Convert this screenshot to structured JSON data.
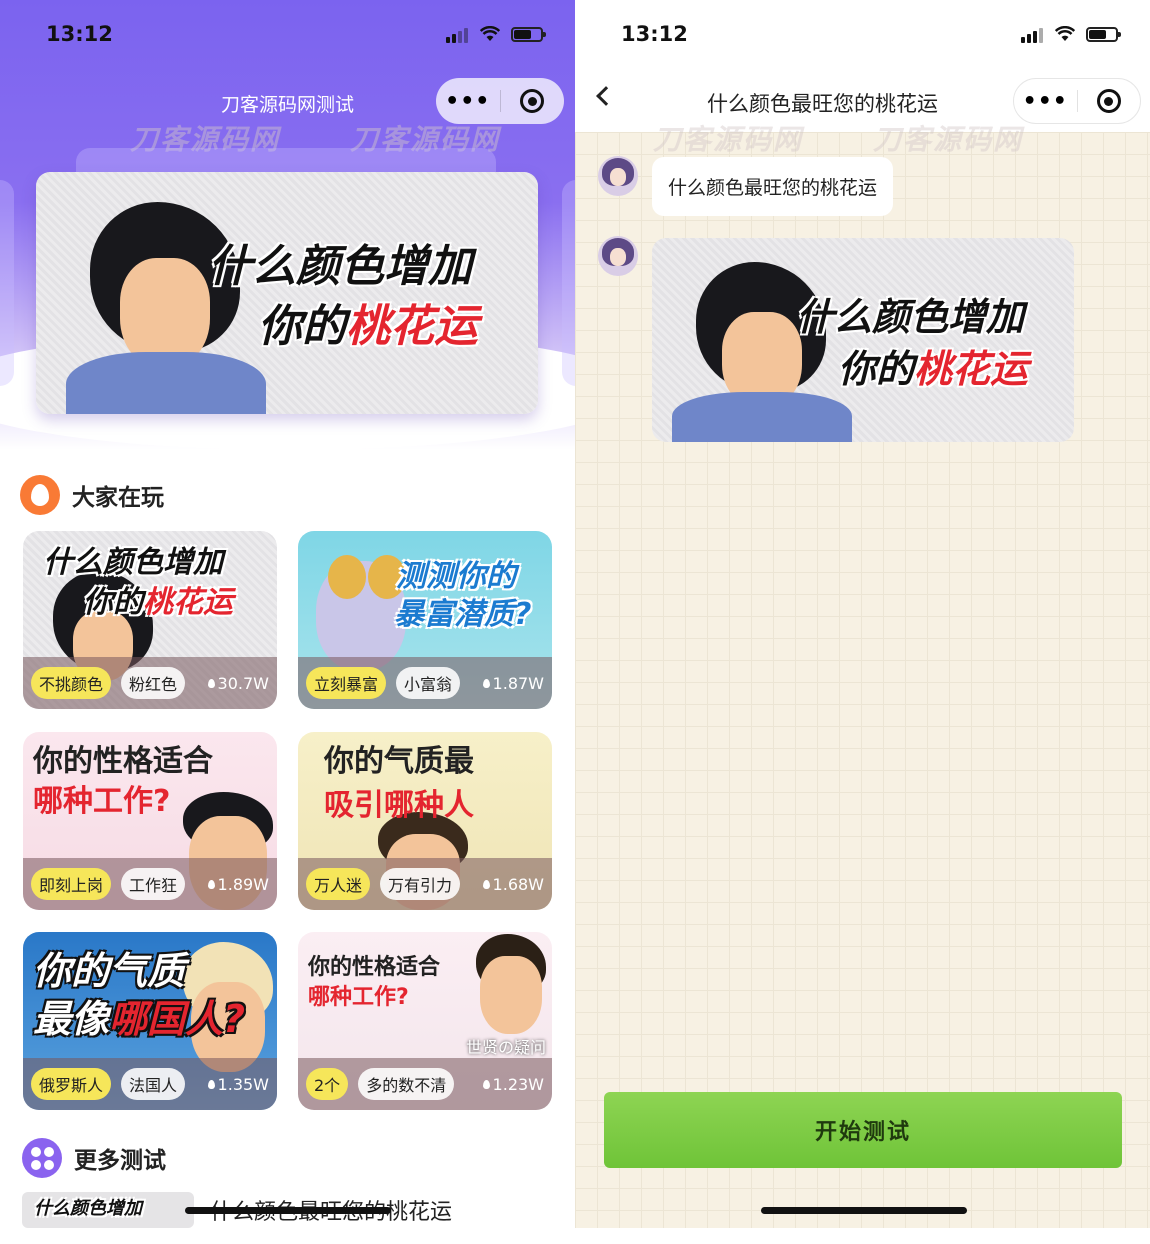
{
  "left": {
    "status": {
      "time": "13:12"
    },
    "nav_title": "刀客源码网测试",
    "watermark": "刀客源码网",
    "banner": {
      "line1": "什么颜色增加",
      "line2_prefix": "你的",
      "line2_highlight": "桃花运"
    },
    "section_popular": "大家在玩",
    "cards": [
      {
        "title1": "什么颜色增加",
        "title2_prefix": "你的",
        "title2_highlight": "桃花运",
        "tag1": "不挑颜色",
        "tag2": "粉红色",
        "count": "30.7W"
      },
      {
        "title1": "测测你的",
        "title2_prefix": "",
        "title2_highlight": "暴富潜质?",
        "tag1": "立刻暴富",
        "tag2": "小富翁",
        "count": "1.87W"
      },
      {
        "title1": "你的性格适合",
        "title2_prefix": "",
        "title2_highlight": "哪种工作?",
        "tag1": "即刻上岗",
        "tag2": "工作狂",
        "count": "1.89W"
      },
      {
        "title1": "你的气质最",
        "title2_prefix": "",
        "title2_highlight": "吸引哪种人",
        "tag1": "万人迷",
        "tag2": "万有引力",
        "count": "1.68W"
      },
      {
        "title1": "你的气质",
        "title2_prefix": "最像",
        "title2_highlight": "哪国人?",
        "tag1": "俄罗斯人",
        "tag2": "法国人",
        "count": "1.35W"
      },
      {
        "title1": "你的性格适合",
        "title2_prefix": "",
        "title2_highlight": "哪种工作?",
        "caption": "世贤の疑问",
        "tag1": "2个",
        "tag2": "多的数不清",
        "count": "1.23W"
      }
    ],
    "section_more": "更多测试",
    "more_items": [
      {
        "label": "什么颜色最旺您的桃花运"
      }
    ]
  },
  "right": {
    "status": {
      "time": "13:12"
    },
    "nav_title": "什么颜色最旺您的桃花运",
    "watermark": "刀客源码网",
    "messages": [
      {
        "text": "什么颜色最旺您的桃花运"
      }
    ],
    "image_message": {
      "line1": "什么颜色增加",
      "line2_prefix": "你的",
      "line2_highlight": "桃花运"
    },
    "start_button": "开始测试"
  },
  "colors": {
    "accent_purple": "#7b63ef",
    "tag_yellow": "#f6e65a",
    "start_green": "#7ccc45",
    "highlight_red": "#e4252f"
  },
  "icons": [
    "signal-icon",
    "wifi-icon",
    "battery-icon",
    "more-dots-icon",
    "target-icon",
    "back-chevron-icon",
    "fire-icon",
    "grid-icon"
  ]
}
